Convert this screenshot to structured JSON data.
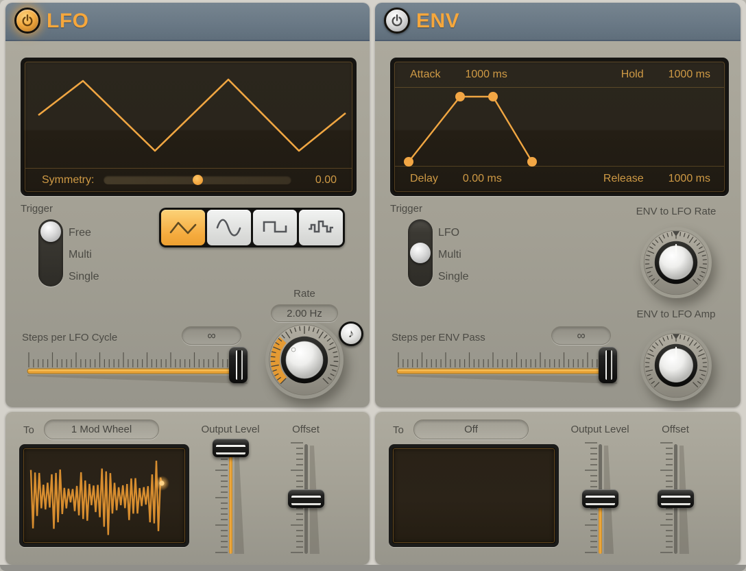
{
  "lfo": {
    "title": "LFO",
    "power_on": true,
    "display": {
      "symmetry_label": "Symmetry:",
      "symmetry_value": "0.00"
    },
    "trigger": {
      "label": "Trigger",
      "options": [
        "Free",
        "Multi",
        "Single"
      ],
      "selected": "Free"
    },
    "waveform_buttons": [
      {
        "name": "triangle",
        "selected": true
      },
      {
        "name": "sine",
        "selected": false
      },
      {
        "name": "square",
        "selected": false
      },
      {
        "name": "sample-hold",
        "selected": false
      }
    ],
    "rate": {
      "label": "Rate",
      "value": "2.00 Hz",
      "note_icon": "♪"
    },
    "steps": {
      "label": "Steps per LFO Cycle",
      "value": "∞"
    },
    "output": {
      "to_label": "To",
      "destination": "1 Mod Wheel",
      "output_level_label": "Output Level",
      "offset_label": "Offset"
    }
  },
  "env": {
    "title": "ENV",
    "power_on": false,
    "display": {
      "attack_label": "Attack",
      "attack_value": "1000 ms",
      "hold_label": "Hold",
      "hold_value": "1000 ms",
      "delay_label": "Delay",
      "delay_value": "0.00 ms",
      "release_label": "Release",
      "release_value": "1000 ms"
    },
    "trigger": {
      "label": "Trigger",
      "options": [
        "LFO",
        "Multi",
        "Single"
      ],
      "selected": "Multi"
    },
    "rate_mod": {
      "label": "ENV to LFO Rate"
    },
    "amp_mod": {
      "label": "ENV to LFO Amp"
    },
    "steps": {
      "label": "Steps per ENV Pass",
      "value": "∞"
    },
    "output": {
      "to_label": "To",
      "destination": "Off",
      "output_level_label": "Output Level",
      "offset_label": "Offset"
    }
  },
  "colors": {
    "accent": "#f2a440",
    "header": "#687784",
    "panel": "#a3a094",
    "display_bg": "#271f14"
  }
}
